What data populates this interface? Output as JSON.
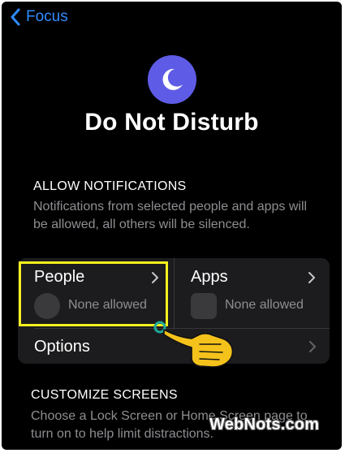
{
  "nav": {
    "back_label": "Focus"
  },
  "focus": {
    "icon": "moon-icon",
    "icon_color": "#5e5ce6",
    "title": "Do Not Disturb"
  },
  "allow_notifications": {
    "header": "ALLOW NOTIFICATIONS",
    "description": "Notifications from selected people and apps will be allowed, all others will be silenced.",
    "people": {
      "label": "People",
      "status": "None allowed"
    },
    "apps": {
      "label": "Apps",
      "status": "None allowed"
    },
    "options_label": "Options"
  },
  "customize_screens": {
    "header": "CUSTOMIZE SCREENS",
    "description": "Choose a Lock Screen or Home Screen page to turn on to help limit distractions."
  },
  "annotation": {
    "highlight_color": "#f5f01e",
    "pointer_icon": "hand-pointer-icon"
  },
  "watermark": "WebNots.com",
  "colors": {
    "accent": "#2f8cff",
    "background": "#000000",
    "card": "#1c1c1e",
    "secondary_text": "#8e8e93"
  }
}
